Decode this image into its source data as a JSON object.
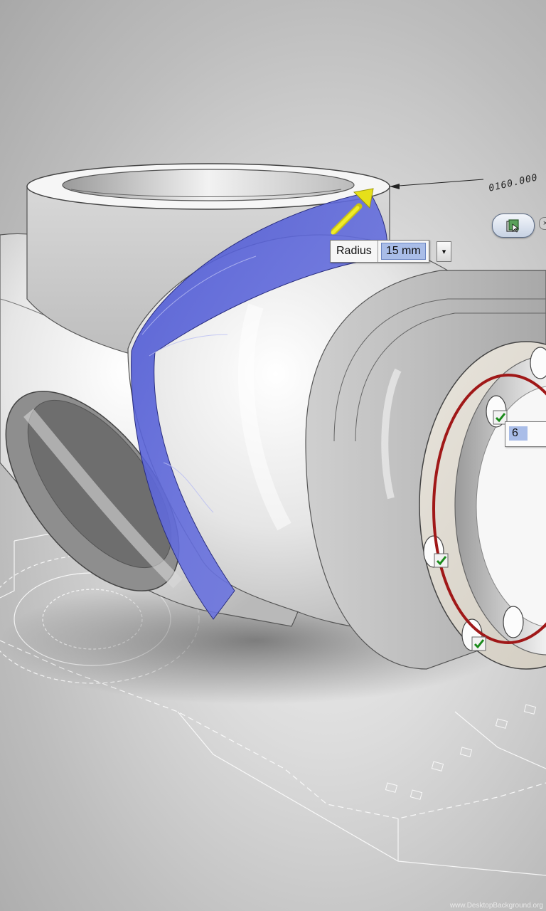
{
  "dimension": {
    "text": "0160.000"
  },
  "fillet_tool": {
    "label": "Radius",
    "value": "15 mm",
    "dropdown_glyph": "▾"
  },
  "pattern_tool": {
    "count": "6"
  },
  "mini_toolbar": {
    "icon": "apply-icon",
    "close_glyph": "×"
  },
  "watermark": {
    "text": "www.DesktopBackground.org"
  },
  "colors": {
    "selection": "#5a64d8",
    "pattern_circle": "#a01818",
    "check": "#1a8a1a",
    "arrow": "#e6e01a"
  }
}
